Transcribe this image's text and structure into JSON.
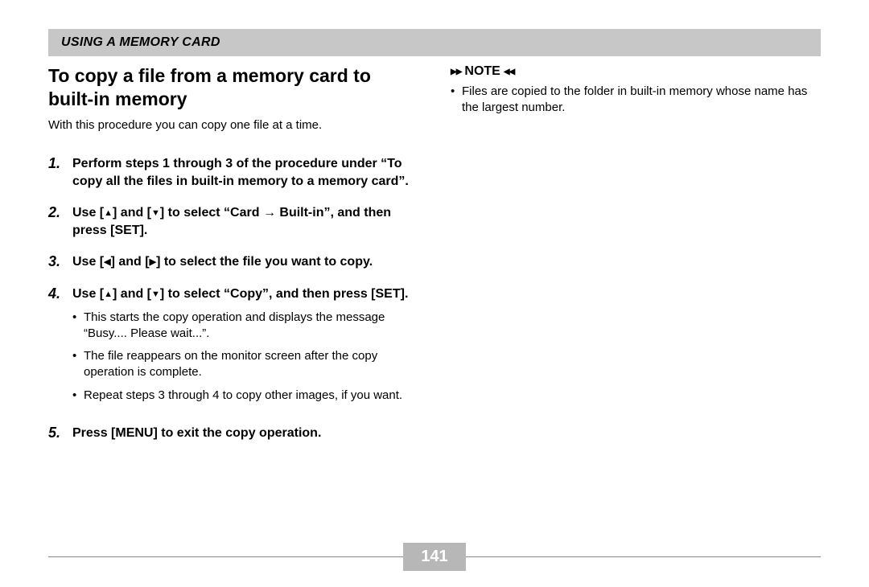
{
  "header": {
    "section_title": "USING A MEMORY CARD"
  },
  "left": {
    "heading": "To copy a file from a memory card to built-in memory",
    "intro": "With this procedure you can copy one file at a time.",
    "steps": {
      "s1": {
        "num": "1.",
        "text": "Perform steps 1 through 3 of the procedure under “To copy all the files in built-in memory to a memory card”."
      },
      "s2": {
        "num": "2.",
        "pre": "Use [",
        "mid1": "] and [",
        "mid2": "] to select “Card ",
        "arrow": "→",
        "post": " Built-in”, and then press [SET]."
      },
      "s3": {
        "num": "3.",
        "pre": "Use [",
        "mid1": "] and [",
        "post": "] to select the file you want to copy."
      },
      "s4": {
        "num": "4.",
        "pre": "Use [",
        "mid1": "] and [",
        "post": "] to select “Copy”, and then press [SET].",
        "b1": "This starts the copy operation and displays the message “Busy.... Please wait...”.",
        "b2": "The file reappears on the monitor screen after the copy operation is complete.",
        "b3": "Repeat steps 3 through 4 to copy other images, if you want."
      },
      "s5": {
        "num": "5.",
        "text": "Press [MENU] to exit the copy operation."
      }
    }
  },
  "right": {
    "note_label": "NOTE",
    "note_item": "Files are copied to the folder in built-in memory whose name has the largest number."
  },
  "footer": {
    "page_number": "141"
  }
}
